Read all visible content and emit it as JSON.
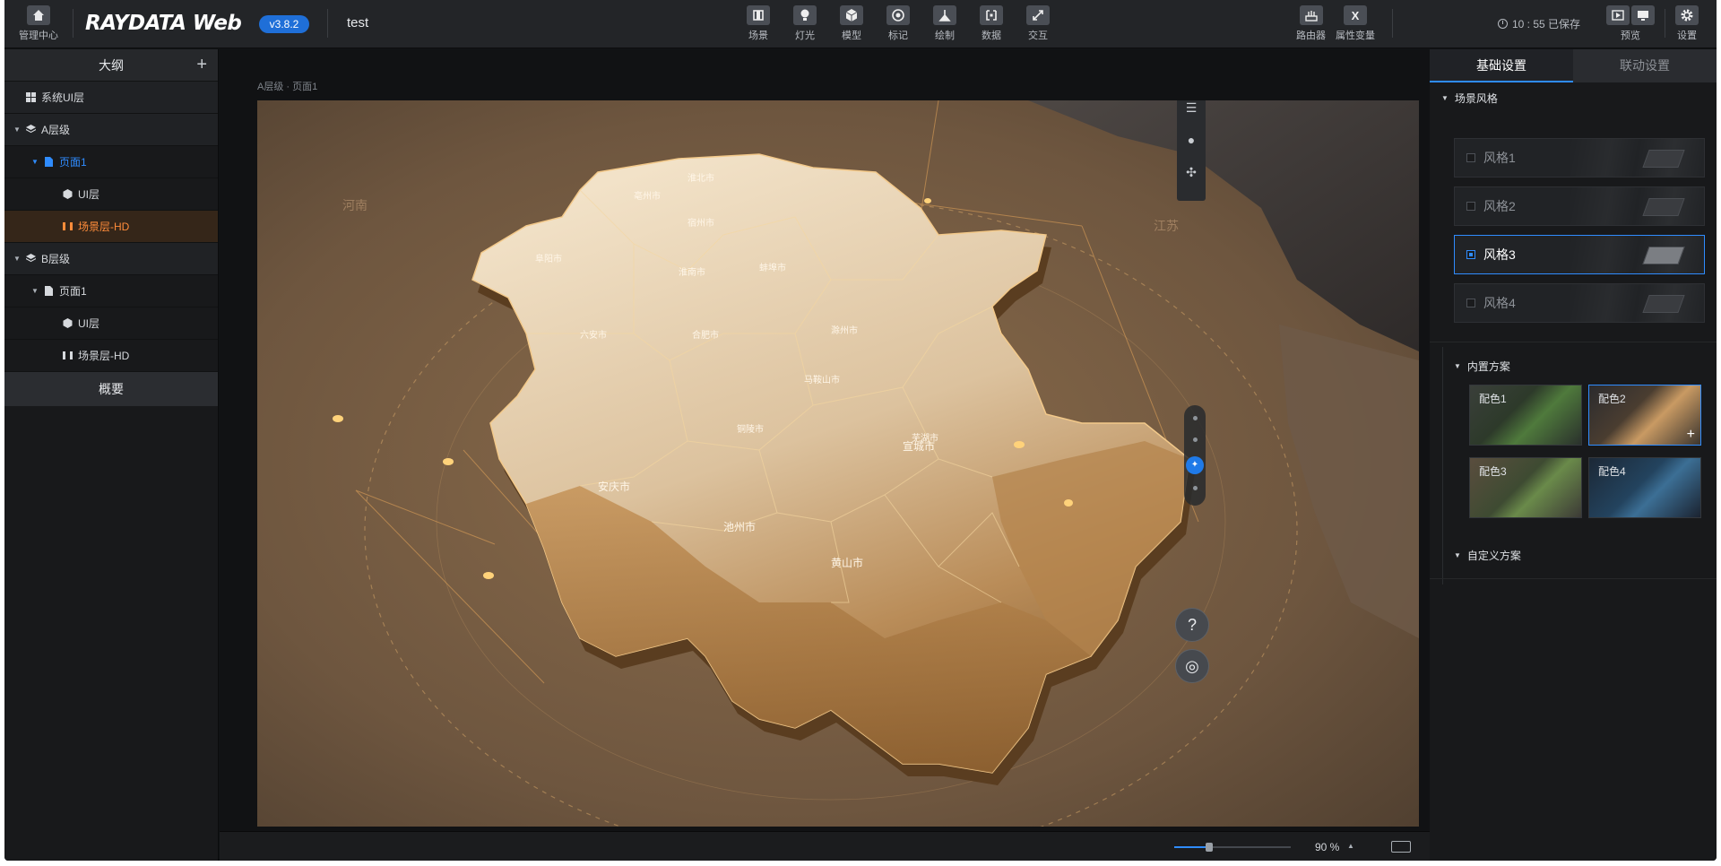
{
  "topbar": {
    "home_label": "管理中心",
    "logo": "RAYDATA Web",
    "version": "v3.8.2",
    "project_name": "test",
    "tools": [
      {
        "label": "场景",
        "icon": "scene-icon"
      },
      {
        "label": "灯光",
        "icon": "light-icon"
      },
      {
        "label": "模型",
        "icon": "model-icon"
      },
      {
        "label": "标记",
        "icon": "marker-icon"
      },
      {
        "label": "绘制",
        "icon": "draw-icon"
      },
      {
        "label": "数据",
        "icon": "data-icon"
      },
      {
        "label": "交互",
        "icon": "interaction-icon"
      }
    ],
    "router_label": "路由器",
    "property_variable_label": "属性变量",
    "save_status": "10 : 55 已保存",
    "preview_label": "预览",
    "settings_label": "设置"
  },
  "left_panel": {
    "title": "大纲",
    "items": [
      {
        "label": "系统UI层"
      },
      {
        "label": "A层级"
      },
      {
        "label": "页面1"
      },
      {
        "label": "UI层"
      },
      {
        "label": "场景层-HD"
      },
      {
        "label": "B层级"
      },
      {
        "label": "页面1"
      },
      {
        "label": "UI层"
      },
      {
        "label": "场景层-HD"
      }
    ],
    "footer": "概要"
  },
  "canvas": {
    "breadcrumb": "A层级 · 页面1",
    "map_labels": [
      "阜阳市",
      "亳州市",
      "淮北市",
      "宿州市",
      "蚌埠市",
      "淮南市",
      "六安市",
      "合肥市",
      "滁州市",
      "马鞍山市",
      "芜湖市",
      "铜陵市",
      "安庆市",
      "池州市",
      "黄山市",
      "宣城市",
      "河南",
      "江苏"
    ],
    "help_button": "?"
  },
  "statusbar": {
    "zoom": "90 %",
    "zoom_level": 0.3
  },
  "right_panel": {
    "tabs": [
      "基础设置",
      "联动设置"
    ],
    "scene_style_title": "场景风格",
    "styles": [
      "风格1",
      "风格2",
      "风格3",
      "风格4"
    ],
    "selected_style": "风格3",
    "builtin_title": "内置方案",
    "schemes": [
      "配色1",
      "配色2",
      "配色3",
      "配色4"
    ],
    "selected_scheme": "配色2",
    "custom_title": "自定义方案"
  },
  "colors": {
    "accent": "#2f8cff",
    "selected_layer": "#ff8c3a",
    "background": "#111315"
  }
}
